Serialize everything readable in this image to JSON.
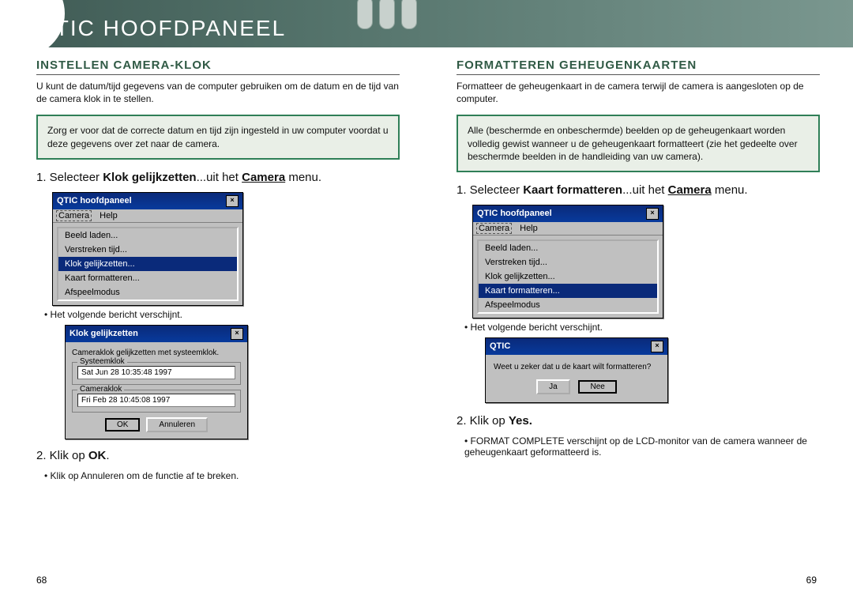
{
  "header": {
    "title": "QTIC HOOFDPANEEL"
  },
  "left": {
    "section": "Instellen Camera-klok",
    "intro": "U kunt de datum/tijd gegevens van de computer gebruiken om de datum en de tijd van de camera klok in te stellen.",
    "note": "Zorg er voor dat de correcte datum en tijd zijn ingesteld in uw computer voordat u deze gegevens over zet naar de camera.",
    "step1_pre": "1. Selecteer ",
    "step1_b": "Klok gelijkzetten",
    "step1_mid": "...uit het ",
    "step1_u": "Camera",
    "step1_post": " menu.",
    "win_title": "QTIC hoofdpaneel",
    "menu_camera": "Camera",
    "menu_help": "Help",
    "items": [
      "Beeld laden...",
      "Verstreken tijd...",
      "Klok gelijkzetten...",
      "Kaart formatteren...",
      "Afspeelmodus"
    ],
    "sel_index": 2,
    "sub1": "Het volgende bericht verschijnt.",
    "dlg_title": "Klok gelijkzetten",
    "dlg_msg": "Cameraklok gelijkzetten met systeemklok.",
    "grp1": "Systeemklok",
    "val1": "Sat Jun 28 10:35:48 1997",
    "grp2": "Cameraklok",
    "val2": "Fri Feb 28 10:45:08 1997",
    "btn_ok": "OK",
    "btn_cancel": "Annuleren",
    "step2": "2. Klik op ",
    "step2_b": "OK",
    "sub2": "Klik op Annuleren om de functie af te breken."
  },
  "right": {
    "section": "Formatteren Geheugenkaarten",
    "intro": "Formatteer de geheugenkaart in de camera terwijl de camera is aangesloten op de computer.",
    "note": "Alle (beschermde en onbeschermde) beelden op de geheugenkaart worden volledig gewist wanneer u de geheugenkaart formatteert (zie het gedeelte over beschermde beelden in de handleiding van uw camera).",
    "step1_pre": "1. Selecteer ",
    "step1_b": "Kaart formatteren",
    "step1_mid": "...uit het ",
    "step1_u": "Camera",
    "step1_post": " menu.",
    "win_title": "QTIC hoofdpaneel",
    "menu_camera": "Camera",
    "menu_help": "Help",
    "items": [
      "Beeld laden...",
      "Verstreken tijd...",
      "Klok gelijkzetten...",
      "Kaart formatteren...",
      "Afspeelmodus"
    ],
    "sel_index": 3,
    "sub1": "Het volgende bericht verschijnt.",
    "dlg_title": "QTIC",
    "dlg_msg": "Weet u zeker dat u de kaart wilt formatteren?",
    "btn_yes": "Ja",
    "btn_no": "Nee",
    "step2": "2. Klik op ",
    "step2_b": "Yes.",
    "sub2": "FORMAT COMPLETE verschijnt op de LCD-monitor van de camera wanneer de geheugenkaart geformatteerd is."
  },
  "pages": {
    "left": "68",
    "right": "69"
  }
}
